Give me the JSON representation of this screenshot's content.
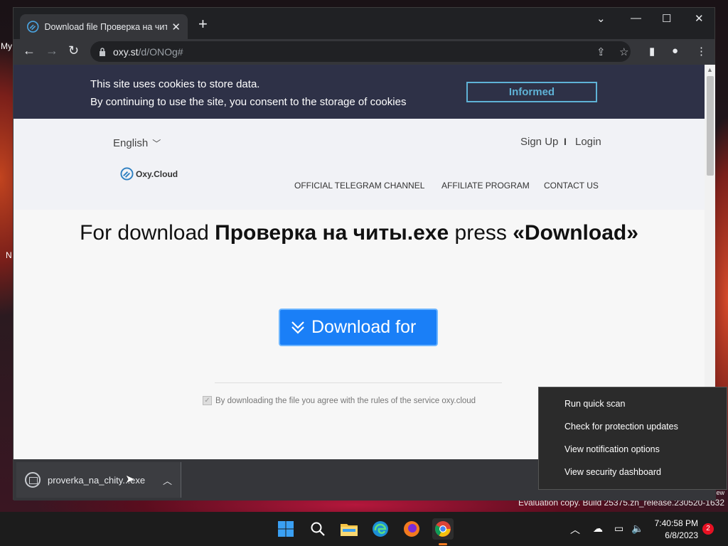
{
  "desktop": {
    "label_left_1": "My",
    "label_left_2": "N",
    "eval_suffix": "ew",
    "evaluation_text": "Evaluation copy. Build 25375.zn_release.230520-1632"
  },
  "browser": {
    "tab": {
      "title": "Download file Проверка на читы.",
      "close": "✕"
    },
    "new_tab": "+",
    "window_controls": {
      "tab_search": "⌄",
      "minimize": "—",
      "maximize": "☐",
      "close": "✕"
    },
    "nav": {
      "back": "←",
      "forward": "→",
      "reload": "↻"
    },
    "url": {
      "host": "oxy.st",
      "path": "/d/ONOg#"
    },
    "omnibox_icons": {
      "share": "⇪",
      "bookmark": "☆"
    },
    "toolbar_icons": {
      "sidepanel": "▮",
      "profile": "●",
      "menu": "⋮"
    }
  },
  "page": {
    "cookie": {
      "line1": "This site uses cookies to store data.",
      "line2": "By continuing to use the site, you consent to the storage of cookies",
      "button": "Informed"
    },
    "header": {
      "language": "English",
      "sign_up": "Sign Up",
      "separator": "I",
      "login": "Login",
      "logo": "Oxy.Cloud",
      "nav": [
        "OFFICIAL TELEGRAM CHANNEL",
        "AFFILIATE PROGRAM",
        "CONTACT US"
      ]
    },
    "title": {
      "prefix": "For download ",
      "filename": "Проверка на читы.exe",
      "middle": " press ",
      "action": "«Download»"
    },
    "download_button": "Download for",
    "agree_text": "By downloading the file you agree with the rules of the service oxy.cloud",
    "agree_checked": true
  },
  "download_shelf": {
    "file_name": "proverka_na_chity...exe"
  },
  "context_menu": {
    "items": [
      "Run quick scan",
      "Check for protection updates",
      "View notification options",
      "View security dashboard"
    ]
  },
  "taskbar": {
    "apps": [
      "windows-start",
      "search",
      "file-explorer",
      "edge",
      "firefox",
      "chrome"
    ],
    "clock_time": "7:40:58 PM",
    "clock_date": "6/8/2023",
    "notification_count": "2"
  },
  "colors": {
    "cookie_bar_bg": "#2e3147",
    "informed_accent": "#5fb2d6",
    "download_button": "#1a7ff7",
    "chrome_dark": "#202124"
  }
}
